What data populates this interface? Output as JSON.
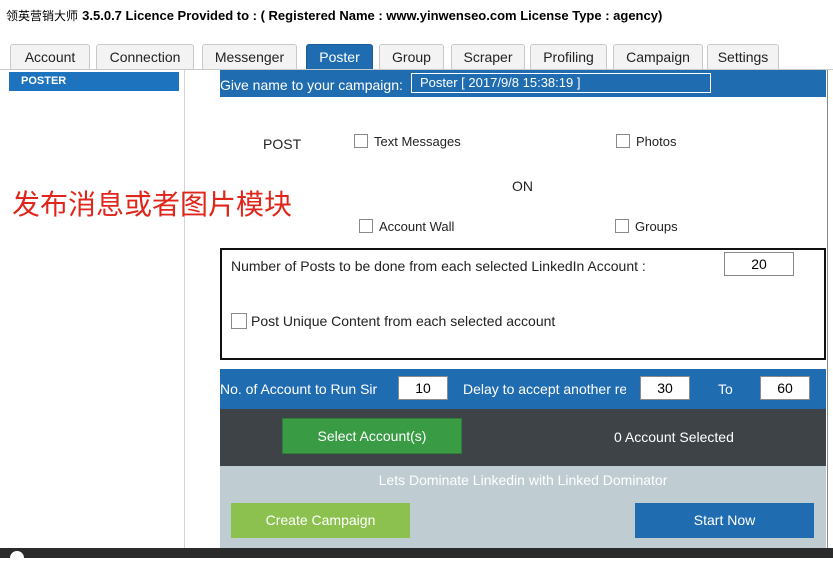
{
  "titlebar": {
    "app_name": "领英营销大师",
    "licence": "3.5.0.7 Licence Provided to : ( Registered Name : www.yinwenseo.com License Type : agency)"
  },
  "tabs": [
    "Account",
    "Connection",
    "Messenger",
    "Poster",
    "Group",
    "Scraper",
    "Profiling",
    "Campaign",
    "Settings"
  ],
  "active_tab": "Poster",
  "sidebar": {
    "items": [
      "POSTER"
    ]
  },
  "annotation": "发布消息或者图片模块",
  "campaign": {
    "name_label": "Give name to your campaign:",
    "name_value": "Poster [ 2017/9/8 15:38:19 ]"
  },
  "post_options": {
    "post_label": "POST",
    "on_label": "ON",
    "text_messages": "Text Messages",
    "photos": "Photos",
    "account_wall": "Account Wall",
    "groups": "Groups"
  },
  "posts": {
    "count_label": "Number of Posts to be done from each selected LinkedIn Account :",
    "count_value": "20",
    "unique_label": "Post Unique Content from each selected account"
  },
  "run": {
    "accounts_label": "No. of Account to Run Sir",
    "accounts_value": "10",
    "delay_label": "Delay to accept another re",
    "delay_from": "30",
    "to_label": "To",
    "delay_to": "60"
  },
  "selection": {
    "button": "Select Account(s)",
    "count_text": "0 Account Selected"
  },
  "footer": {
    "slogan": "Lets Dominate Linkedin with Linked Dominator",
    "create_button": "Create Campaign",
    "start_button": "Start Now"
  },
  "colors": {
    "accent_blue": "#1f6cb0",
    "dark_bar": "#3d4347",
    "select_green": "#3a9b45",
    "create_green": "#8cc14f",
    "footer_grey": "#bfccd2",
    "annotation_red": "#e0261b"
  }
}
